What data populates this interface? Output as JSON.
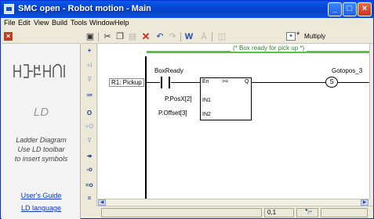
{
  "window": {
    "title": "SMC open - Robot motion - Main",
    "controls": {
      "minimize": "_",
      "maximize": "□",
      "close": "×"
    }
  },
  "menubar": {
    "items": [
      "File",
      "Edit",
      "View",
      "Build",
      "Tools",
      "Window",
      "Help"
    ]
  },
  "toolbar": {
    "icons": [
      "save-icon",
      "cut-icon",
      "copy-icon",
      "paste-icon",
      "delete-icon",
      "undo-icon",
      "redo-icon",
      "watch-icon",
      "font-icon",
      "layout-icon",
      "select-block-icon"
    ],
    "selected_block": "Multiply"
  },
  "left_panel": {
    "logo_text": "ЧЁЧЕН",
    "language_abbr": "LD",
    "language_desc": [
      "Ladder Diagram",
      "Use LD toolbar",
      "to insert symbols"
    ],
    "links": [
      "User's Guide",
      "LD language"
    ]
  },
  "ld_toolbar": {
    "items": [
      "+",
      "+I",
      "⊽",
      "≕",
      "O",
      "+O",
      "⊽",
      "↠",
      "-o",
      "≈o",
      "="
    ]
  },
  "diagram": {
    "comment": "(* Box ready for pick up *)",
    "rung_label": "R1: Pickup",
    "contact_label": "BoxReady",
    "block": {
      "en": "En",
      "op": ">=",
      "out": "Q",
      "in1": "IN1",
      "in2": "IN2"
    },
    "in1_var": "P.PosX[2]",
    "in2_var": "P.Offset[3]",
    "coil_symbol": "S",
    "coil_label": "Gotopos_3"
  },
  "statusbar": {
    "position": "0,1"
  },
  "colors": {
    "title_blue": "#0546d6",
    "comment_green": "#58c242",
    "link_blue": "#0b3bc4"
  }
}
